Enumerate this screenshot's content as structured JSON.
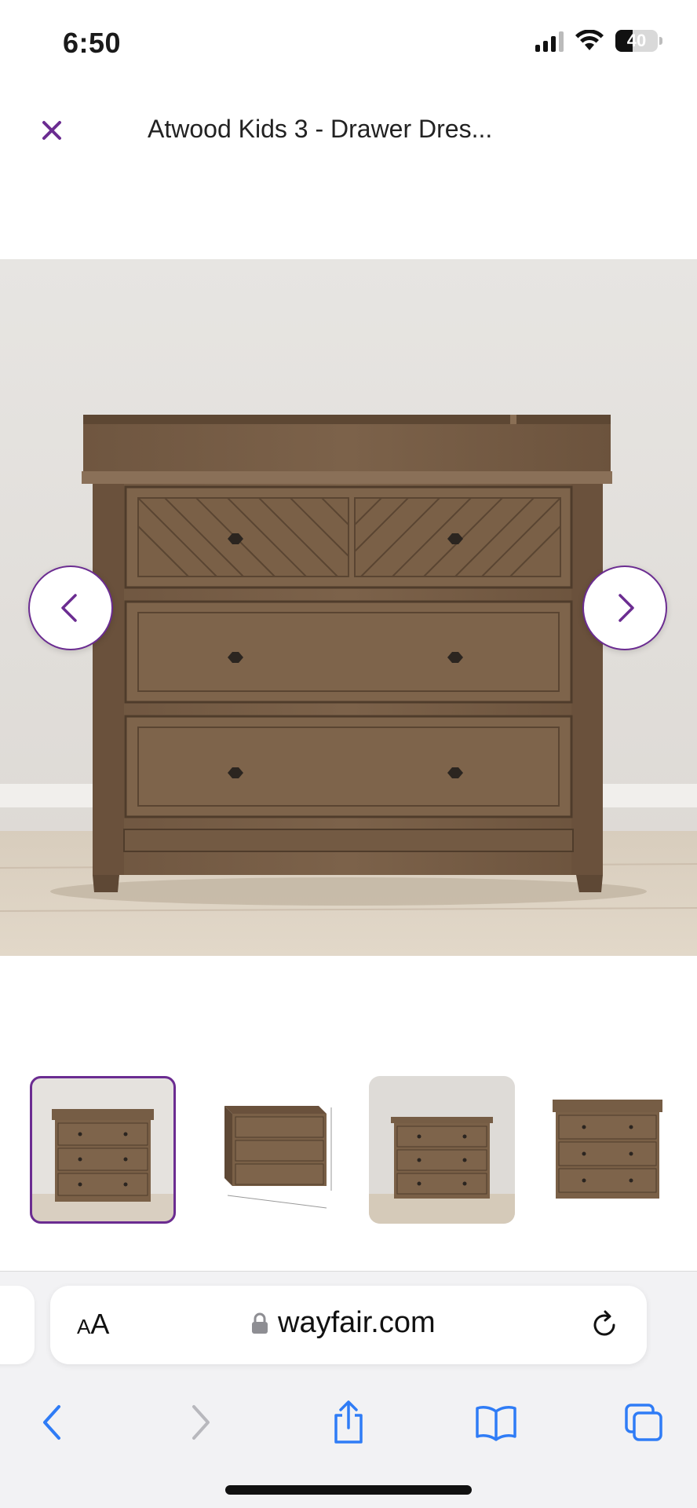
{
  "status_bar": {
    "time": "6:50",
    "battery_level": "40",
    "battery_fraction": 0.4
  },
  "header": {
    "title": "Atwood Kids 3 - Drawer Dres...",
    "close_icon": "close-icon"
  },
  "gallery": {
    "main_image": "dresser-front-photo",
    "prev_icon": "chevron-left-icon",
    "next_icon": "chevron-right-icon",
    "selected_thumbnail": 0,
    "thumbnails": [
      {
        "name": "dresser-front-thumbnail"
      },
      {
        "name": "dresser-dimensions-thumbnail"
      },
      {
        "name": "dresser-room-thumbnail"
      },
      {
        "name": "dresser-changing-top-thumbnail"
      }
    ]
  },
  "browser": {
    "text_size_label": "AA",
    "url": "wayfair.com",
    "lock_icon": "lock-icon",
    "reload_icon": "reload-icon",
    "toolbar": [
      "back-icon",
      "forward-icon",
      "share-icon",
      "bookmarks-icon",
      "tabs-icon"
    ]
  },
  "colors": {
    "accent": "#6b2c91",
    "safari_blue": "#2f7cf6",
    "wood": "#7a6148"
  }
}
